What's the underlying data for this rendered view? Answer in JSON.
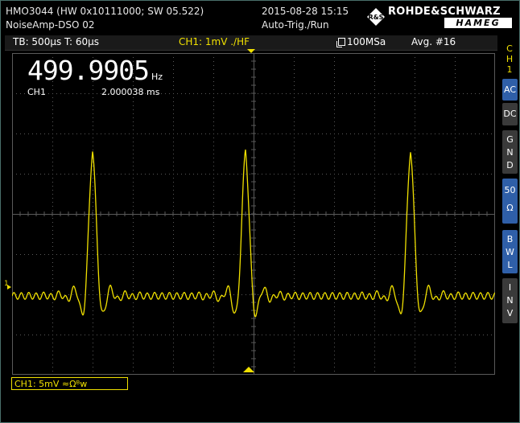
{
  "header": {
    "model": "HMO3044 (HW 0x10111000; SW 05.522)",
    "setup_name": "NoiseAmp-DSO 02",
    "datetime": "2015-08-28 15:15",
    "trigger_mode": "Auto-Trig./Run",
    "brand_primary": "ROHDE&SCHWARZ",
    "brand_secondary": "HAMEG",
    "brand_logo_mark": "R&S"
  },
  "status": {
    "timebase": "TB: 500µs  T: 60µs",
    "channel_info": "CH1: 1mV ./HF",
    "memory_icon": "memory-icon",
    "sample_rate": "100MSa",
    "average": "Avg. #16"
  },
  "measurement": {
    "frequency": "499.9905",
    "frequency_unit": "Hz",
    "source": "CH1",
    "period": "2.000038 ms"
  },
  "channel_label": "CH1: 5mV ≈Ωᴮw",
  "ground_marker": "1",
  "side_menu": {
    "title": [
      "C",
      "H",
      "1"
    ],
    "buttons": [
      {
        "label": [
          "AC"
        ],
        "active": true
      },
      {
        "label": [
          "DC"
        ],
        "active": false
      },
      {
        "label": [
          "G",
          "N",
          "D"
        ],
        "active": false
      },
      {
        "label": [
          "50",
          "Ω"
        ],
        "active": true
      },
      {
        "label": [
          "B",
          "W",
          "L"
        ],
        "active": true
      },
      {
        "label": [
          "I",
          "N",
          "V"
        ],
        "active": false
      }
    ]
  },
  "colors": {
    "trace": "#f0e000",
    "grid": "#5a5a5a",
    "active_button": "#2f5fa8",
    "inactive_button": "#3a3a3a"
  },
  "chart_data": {
    "type": "line",
    "title": "",
    "xlabel": "",
    "ylabel": "",
    "x_divisions": 12,
    "y_divisions": 8,
    "grid": true,
    "series": [
      {
        "peak_positions_div": [
          2.0,
          5.8,
          9.9
        ],
        "peak_height_div": 4.15,
        "trough_depth_div": -1.0,
        "ripple_amplitude_div": 0.15,
        "baseline_div": 0.0
      }
    ]
  }
}
